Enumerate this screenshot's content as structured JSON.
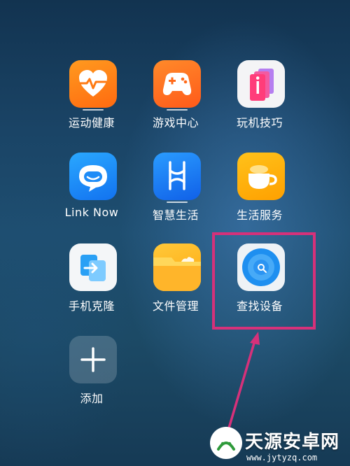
{
  "apps": [
    {
      "id": "sports-health",
      "label": "运动健康"
    },
    {
      "id": "game-center",
      "label": "游戏中心"
    },
    {
      "id": "tips",
      "label": "玩机技巧"
    },
    {
      "id": "link-now",
      "label": "Link Now"
    },
    {
      "id": "ai-life",
      "label": "智慧生活"
    },
    {
      "id": "life-service",
      "label": "生活服务"
    },
    {
      "id": "phone-clone",
      "label": "手机克隆"
    },
    {
      "id": "file-manager",
      "label": "文件管理"
    },
    {
      "id": "find-device",
      "label": "查找设备"
    },
    {
      "id": "add",
      "label": "添加"
    }
  ],
  "annotation": {
    "highlight_color": "#d6317a",
    "highlighted_app": "查找设备"
  },
  "watermark": {
    "title": "天源安卓网",
    "url": "www.jytyzq.com"
  }
}
